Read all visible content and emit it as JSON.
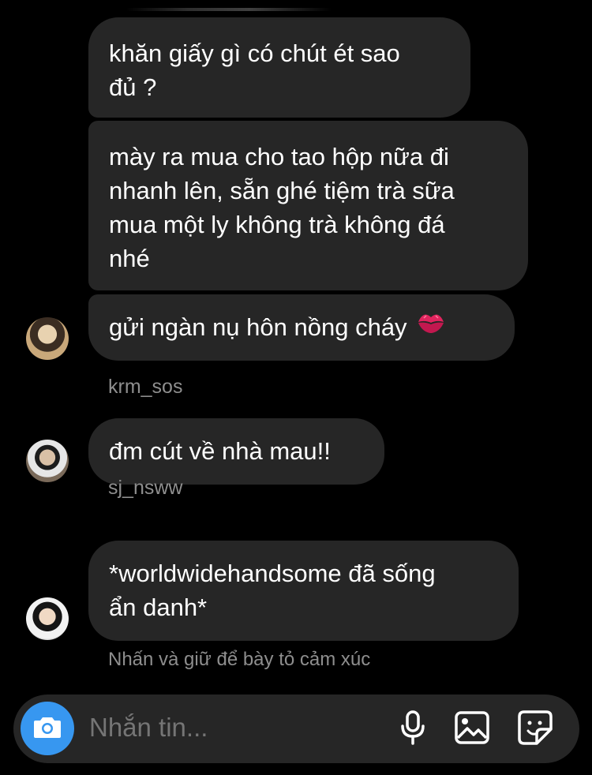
{
  "messages": [
    {
      "text": "khăn giấy gì có chút ét sao\nđủ ?"
    },
    {
      "text": "mày ra mua cho tao hộp nữa đi\nnhanh lên, sẵn ghé tiệm trà sữa\nmua một ly không trà không đá\nnhé"
    },
    {
      "text": "gửi ngàn nụ hôn nồng cháy",
      "emoji": "kiss-mark-icon"
    },
    {
      "text": "đm cút về nhà mau!!"
    },
    {
      "text": "*worldwidehandsome đã sống\nẩn danh*"
    }
  ],
  "senders": [
    "krm_sos",
    "sj_nsww"
  ],
  "reaction_hint": "Nhấn và giữ để bày tỏ cảm xúc",
  "composer": {
    "placeholder": "Nhắn tin...",
    "icons": [
      "camera-icon",
      "microphone-icon",
      "gallery-icon",
      "sticker-icon"
    ]
  },
  "colors": {
    "background": "#000000",
    "bubble": "#262626",
    "muted_text": "#8e8e8e",
    "camera_button": "#3797f0"
  }
}
